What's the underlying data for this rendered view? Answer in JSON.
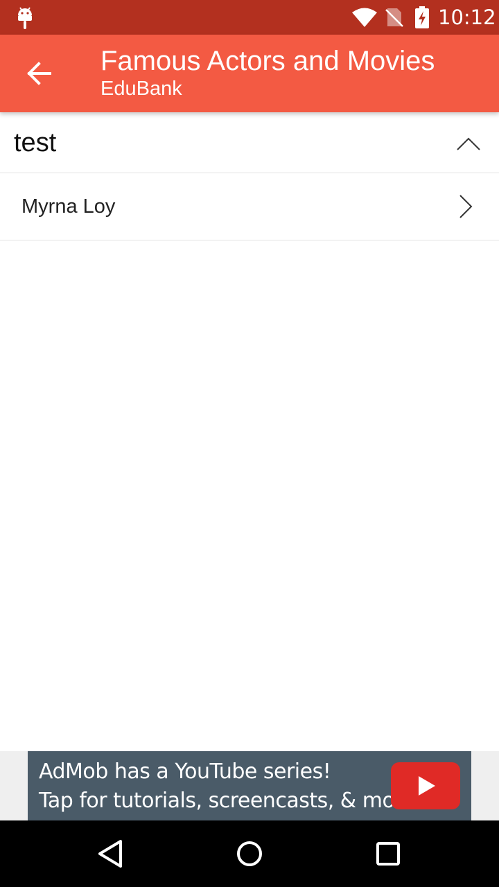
{
  "status_bar": {
    "time": "10:12",
    "icons": [
      "android-icon",
      "wifi-icon",
      "no-sim-icon",
      "battery-charging-icon"
    ],
    "background": "#b3301f"
  },
  "app_bar": {
    "title": "Famous Actors and Movies",
    "subtitle": "EduBank",
    "back_icon": "arrow-back-icon",
    "background": "#f35a43"
  },
  "section": {
    "title": "test",
    "expanded": true,
    "toggle_icon": "chevron-up-icon"
  },
  "list": {
    "items": [
      {
        "label": "Myrna Loy",
        "icon": "chevron-right-icon"
      }
    ]
  },
  "ad": {
    "line1": "AdMob has a YouTube series!",
    "line2": "Tap for tutorials, screencasts, & more.",
    "icon": "youtube-play-icon",
    "background": "#4a5b68"
  },
  "nav_bar": {
    "buttons": [
      "back-triangle-icon",
      "home-circle-icon",
      "recents-square-icon"
    ]
  }
}
